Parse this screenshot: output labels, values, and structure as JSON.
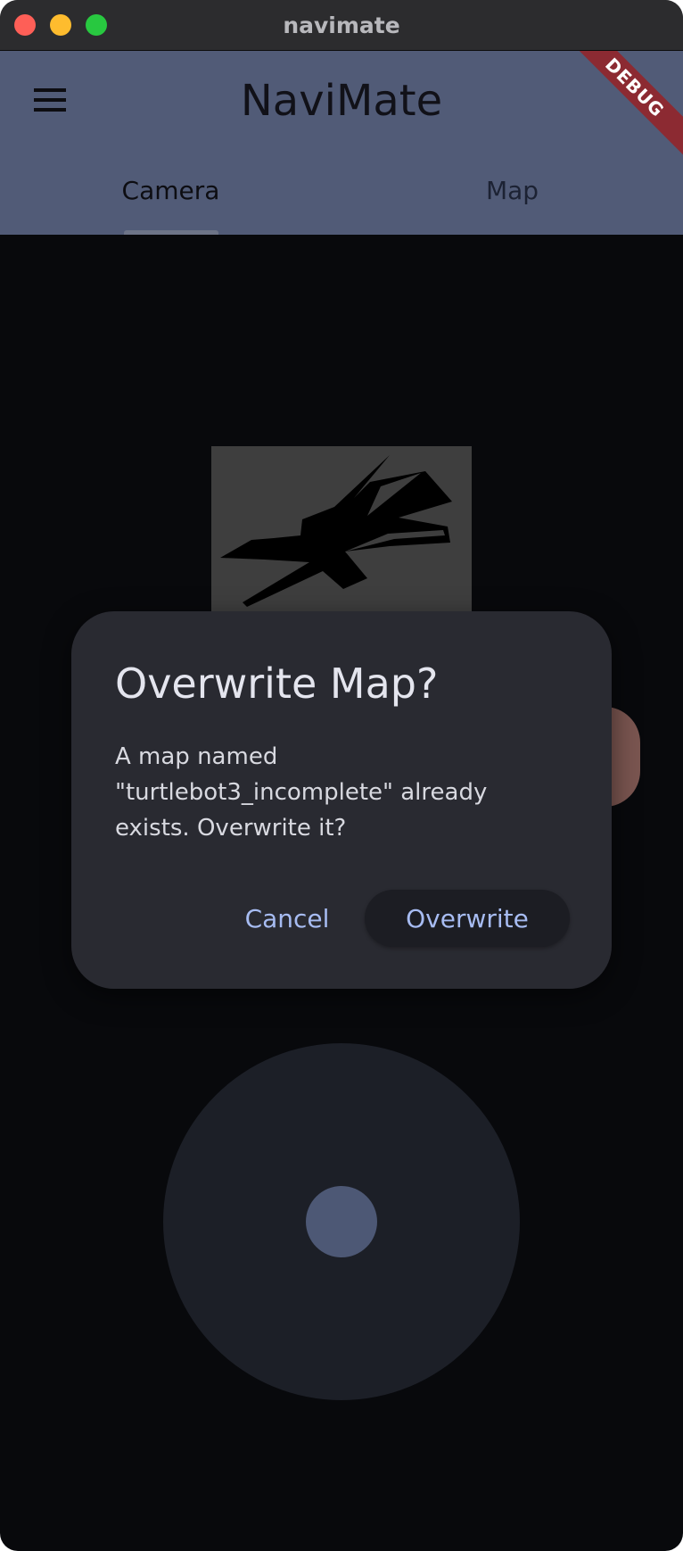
{
  "window": {
    "title": "navimate"
  },
  "appbar": {
    "title": "NaviMate",
    "menu_icon": "hamburger-menu-icon",
    "debug_banner": "DEBUG",
    "tabs": [
      {
        "label": "Camera",
        "selected": true
      },
      {
        "label": "Map",
        "selected": false
      }
    ]
  },
  "dialog": {
    "title": "Overwrite Map?",
    "body_lines": [
      "A map named",
      "\"turtlebot3_incomplete\" already",
      "exists. Overwrite it?"
    ],
    "cancel_label": "Cancel",
    "confirm_label": "Overwrite"
  },
  "colors": {
    "appbar_bg": "#515b77",
    "background": "#08090c",
    "dialog_bg": "#292a31",
    "button_text": "#a7bcf2",
    "joystick_bg": "#1c1f27",
    "joystick_knob": "#4d5875",
    "debug_ribbon": "#8c2a32"
  }
}
